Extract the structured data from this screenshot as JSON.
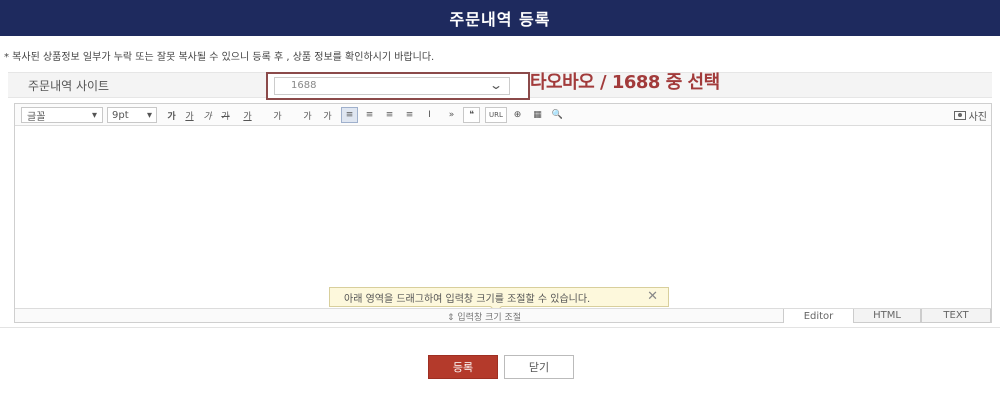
{
  "header": {
    "title": "주문내역 등록"
  },
  "notice": "* 복사된 상품정보 일부가 누락 또는 잘못 복사될 수 있으니 등록 후 , 상품 정보를 확인하시기 바랍니다.",
  "site_row": {
    "label": "주문내역 사이트",
    "select_value": "1688",
    "annotation": "타오바오 / 1688 중 선택"
  },
  "toolbar": {
    "font_label": "글꼴",
    "size_label": "9pt",
    "glyphs": [
      "가",
      "가",
      "가",
      "가",
      "가",
      "가",
      "가",
      "가",
      "≡",
      "≡",
      "≡",
      "≡",
      "I",
      "»",
      "❝",
      "URL",
      "⊕",
      "▦",
      "🔍"
    ],
    "photo_label": "사진"
  },
  "tooltip": {
    "text": "아래 영역을 드래그하여 입력창 크기를 조절할 수 있습니다.",
    "close": "✕"
  },
  "resize": {
    "label": "⇕ 입력창 크기 조절"
  },
  "modes": {
    "editor": "Editor",
    "html": "HTML",
    "text": "TEXT"
  },
  "buttons": {
    "register": "등록",
    "close": "닫기"
  },
  "colors": {
    "header": "#1e2a5e",
    "accent": "#b43a2b",
    "annotation": "#a23b3b"
  }
}
